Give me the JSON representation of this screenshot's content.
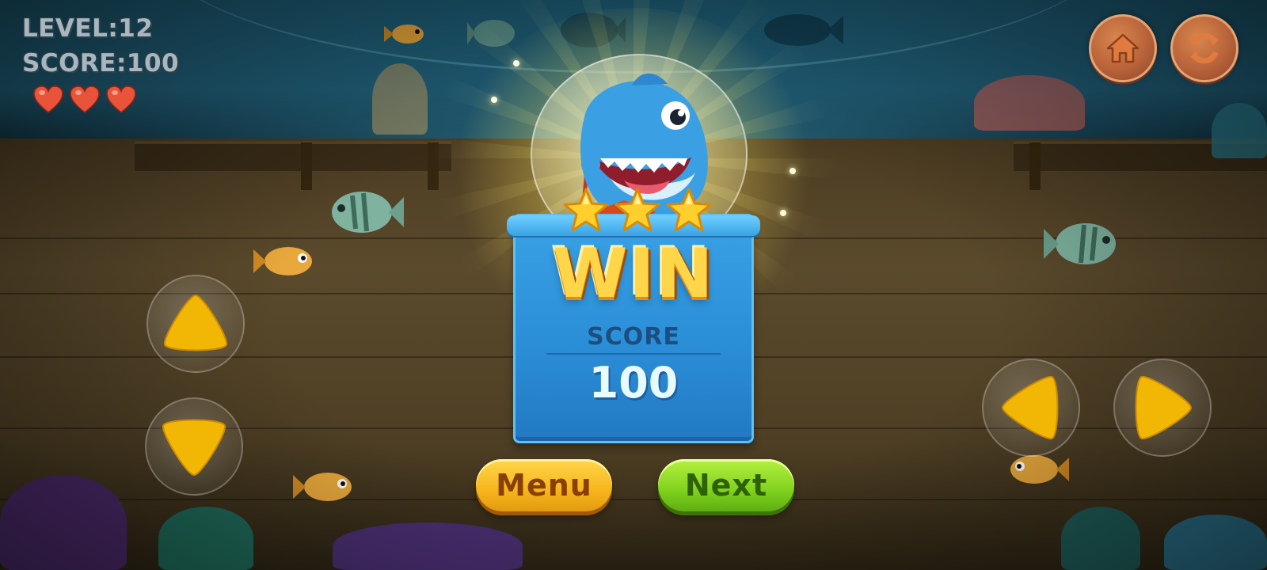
{
  "hud": {
    "level": "LEVEL:12",
    "score": "SCORE:100",
    "lives": 3
  },
  "icons": {
    "home": "home-icon",
    "restart": "restart-icon",
    "heart": "heart-icon",
    "star": "star-icon",
    "arrow_up": "arrow-up-icon",
    "arrow_down": "arrow-down-icon",
    "arrow_left": "arrow-left-icon",
    "arrow_right": "arrow-right-icon"
  },
  "win_panel": {
    "title": "WIN",
    "score_label": "SCORE",
    "score_value": "100",
    "stars_earned": 3,
    "stars_total": 3
  },
  "buttons": {
    "menu": "Menu",
    "next": "Next"
  },
  "colors": {
    "win_gold": "#ffd54a",
    "panel_blue": "#2b8fd8",
    "menu_orange": "#f6b51c",
    "next_green": "#7fd21e",
    "heart_red": "#e8533a",
    "control_yellow": "#f2b705"
  }
}
